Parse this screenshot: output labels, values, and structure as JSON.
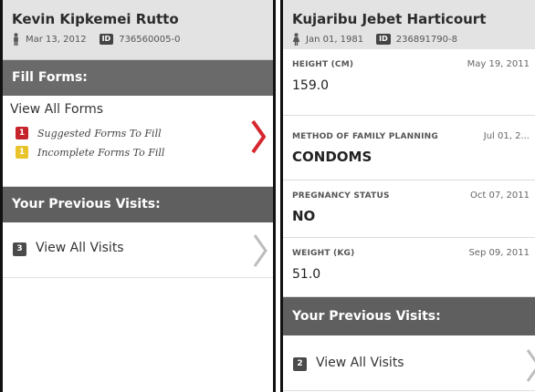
{
  "left_screen": {
    "patient": {
      "name": "Kevin Kipkemei Rutto",
      "birth_date": "Mar 13, 2012",
      "id": "736560005-0"
    },
    "fill_forms": {
      "header": "Fill Forms:",
      "view_all": "View All Forms",
      "items": [
        {
          "badge": "1",
          "label": "Suggested Forms To Fill",
          "color": "#c4242a"
        },
        {
          "badge": "1",
          "label": "Incomplete Forms To Fill",
          "color": "#e8c42a"
        }
      ]
    },
    "previous_visits": {
      "header": "Your Previous Visits:",
      "count": "3",
      "label": "View All Visits"
    }
  },
  "right_screen": {
    "patient": {
      "name": "Kujaribu Jebet Harticourt",
      "birth_date": "Jan 01, 1981",
      "id": "236891790-8"
    },
    "observations": [
      {
        "label": "HEIGHT (CM)",
        "date": "May 19, 2011",
        "value": "159.0"
      },
      {
        "label": "METHOD OF FAMILY PLANNING",
        "date": "Jul 01, 2...",
        "value": "CONDOMS"
      },
      {
        "label": "PREGNANCY STATUS",
        "date": "Oct 07, 2011",
        "value": "NO"
      },
      {
        "label": "WEIGHT (KG)",
        "date": "Sep 09, 2011",
        "value": "51.0"
      }
    ],
    "previous_visits": {
      "header": "Your Previous Visits:",
      "count": "2",
      "label": "View All Visits"
    }
  },
  "icons": {
    "gender_left": "male-icon",
    "gender_right": "female-icon",
    "id": "id-card-icon",
    "chevron_active": "chevron-right-icon"
  },
  "colors": {
    "section_header": "#6a6a6a",
    "header_bg": "#e3e3e3",
    "chevron_active": "#d6262e",
    "chevron_inactive": "#bdbdbd"
  }
}
